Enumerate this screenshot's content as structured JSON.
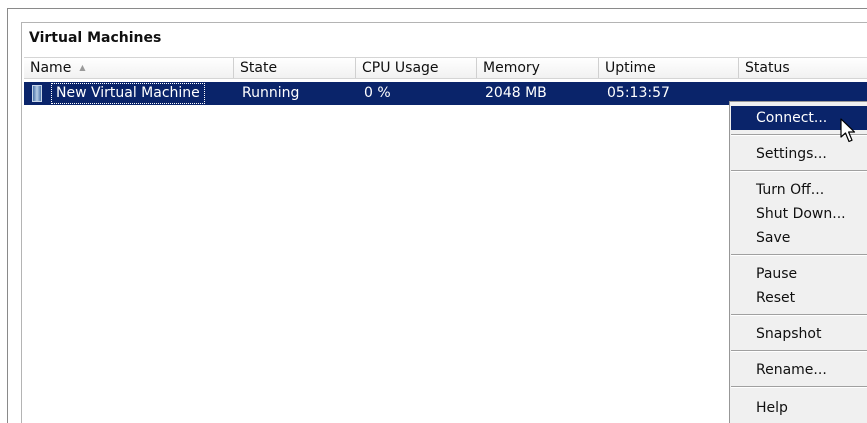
{
  "panel": {
    "title": "Virtual Machines"
  },
  "table": {
    "columns": [
      "Name",
      "State",
      "CPU Usage",
      "Memory",
      "Uptime",
      "Status"
    ],
    "sort_column": "Name",
    "sort_direction": "ascending",
    "rows": [
      {
        "name": "New Virtual Machine",
        "state": "Running",
        "cpu": "0 %",
        "memory": "2048 MB",
        "uptime": "05:13:57",
        "status": ""
      }
    ]
  },
  "context_menu": {
    "items": [
      {
        "label": "Connect..."
      },
      {
        "label": "Settings..."
      },
      {
        "label": "Turn Off..."
      },
      {
        "label": "Shut Down..."
      },
      {
        "label": "Save"
      },
      {
        "label": "Pause"
      },
      {
        "label": "Reset"
      },
      {
        "label": "Snapshot"
      },
      {
        "label": "Rename..."
      },
      {
        "label": "Help"
      }
    ],
    "highlighted": "Connect..."
  },
  "colors": {
    "selection": "#0a246a",
    "menu_background": "#f0f0f0",
    "header_border": "#d0d0d0"
  }
}
